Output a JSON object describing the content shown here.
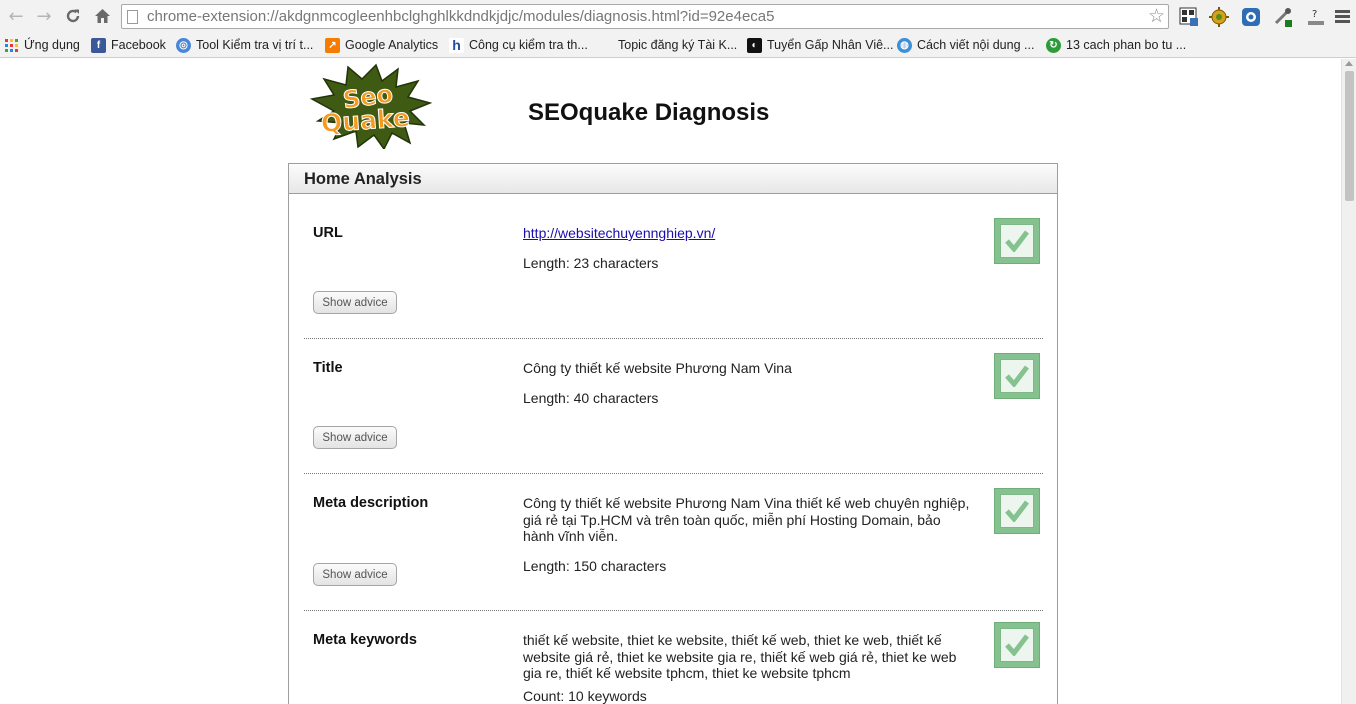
{
  "browser": {
    "url": "chrome-extension://akdgnmcogleenhbclghghlkkdndkjdjc/modules/diagnosis.html?id=92e4eca5",
    "bookmarks": [
      {
        "label": "Ứng dụng",
        "icon": "apps-grid-icon"
      },
      {
        "label": "Facebook",
        "icon": "facebook-icon"
      },
      {
        "label": "Tool Kiểm tra vị trí t...",
        "icon": "globe-icon"
      },
      {
        "label": "Google Analytics",
        "icon": "analytics-icon"
      },
      {
        "label": "Công cụ kiểm tra th...",
        "icon": "h-logo-icon"
      },
      {
        "label": "Topic đăng ký Tài K...",
        "icon": "blank-icon"
      },
      {
        "label": "Tuyển Gấp Nhân Viê...",
        "icon": "site-logo-icon"
      },
      {
        "label": "Cách viết nội dung ...",
        "icon": "blue-globe-icon"
      },
      {
        "label": "13 cach phan bo tu ...",
        "icon": "green-swirl-icon"
      }
    ]
  },
  "page": {
    "logo_line1": "Seo",
    "logo_line2": "Quake",
    "title": "SEOquake Diagnosis",
    "panel_title": "Home Analysis",
    "advice_label": "Show advice",
    "rows": [
      {
        "label": "URL",
        "value": "http://websitechuyennghiep.vn/",
        "meta": "Length: 23 characters",
        "status": "pass"
      },
      {
        "label": "Title",
        "value": "Công ty thiết kế website Phương Nam Vina",
        "meta": "Length: 40 characters",
        "status": "pass"
      },
      {
        "label": "Meta description",
        "value": "Công ty thiết kế website Phương Nam Vina thiết kế web chuyên nghiệp, giá rẻ tại Tp.HCM và trên toàn quốc, miễn phí Hosting Domain, bảo hành vĩnh viễn.",
        "meta": "Length: 150 characters",
        "status": "pass"
      },
      {
        "label": "Meta keywords",
        "value": "thiết kế website, thiet ke website, thiết kế web, thiet ke web, thiết kế website giá rẻ, thiet ke website gia re, thiết kế web giá rẻ, thiet ke web gia re, thiết kế website tphcm, thiet ke website tphcm",
        "meta": "Count: 10 keywords",
        "status": "pass"
      }
    ]
  },
  "colors": {
    "check_green": "#86c28f",
    "link": "#1a0dab",
    "logo_orange": "#f39a1f",
    "logo_green": "#3f5a12"
  }
}
